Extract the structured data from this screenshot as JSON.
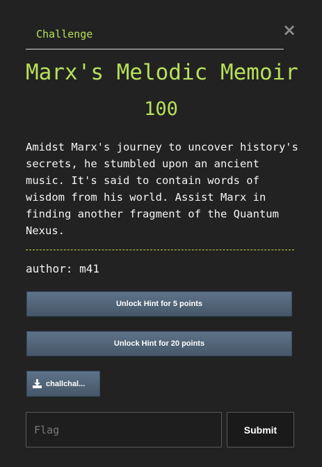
{
  "modal": {
    "tab_label": "Challenge",
    "close_glyph": "×",
    "title": "Marx's Melodic Memoir",
    "points": "100",
    "description": "Amidst Marx's journey to uncover history's secrets, he stumbled upon an ancient music. It's said to contain words of wisdom from his world. Assist Marx in finding another fragment of the Quantum Nexus.",
    "author": "author: m41",
    "hints": [
      {
        "label": "Unlock Hint for 5 points"
      },
      {
        "label": "Unlock Hint for 20 points"
      }
    ],
    "file": {
      "label": "challchal...",
      "icon": "download-icon"
    },
    "flag_input": {
      "placeholder": "Flag",
      "value": ""
    },
    "submit_label": "Submit"
  },
  "colors": {
    "background": "#222222",
    "accent": "#b7e05a",
    "button": "#52657a",
    "text": "#f4f4f4"
  }
}
